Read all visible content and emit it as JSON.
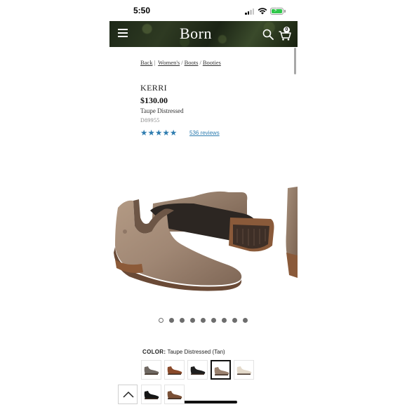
{
  "status": {
    "time": "5:50"
  },
  "header": {
    "brand": "Born",
    "cart_count": "0"
  },
  "breadcrumb": {
    "back": "Back",
    "items": [
      "Women's",
      "Boots",
      "Booties"
    ]
  },
  "product": {
    "name": "KERRI",
    "price": "$130.00",
    "color_name": "Taupe Distressed",
    "sku": "D89955",
    "rating_stars": "★★★★★",
    "rating_value": 5,
    "reviews": "536 reviews"
  },
  "carousel": {
    "total": 9,
    "active_index": 0
  },
  "color_selector": {
    "label": "COLOR:",
    "selected_value": "Taupe Distressed (Tan)",
    "swatches": [
      {
        "name": "Grey Distressed",
        "color": "#6f6862"
      },
      {
        "name": "Brown",
        "color": "#8a4a2a"
      },
      {
        "name": "Black",
        "color": "#1e1e1e"
      },
      {
        "name": "Taupe Distressed (Tan)",
        "color": "#9a8270",
        "selected": true
      },
      {
        "name": "Cream",
        "color": "#e4dacb"
      },
      {
        "name": "Black Full Grain",
        "color": "#151515"
      },
      {
        "name": "Tan Distressed",
        "color": "#7a5036"
      }
    ]
  },
  "colors": {
    "accent_blue": "#2f7db0",
    "header_bg": "#1d2818"
  }
}
